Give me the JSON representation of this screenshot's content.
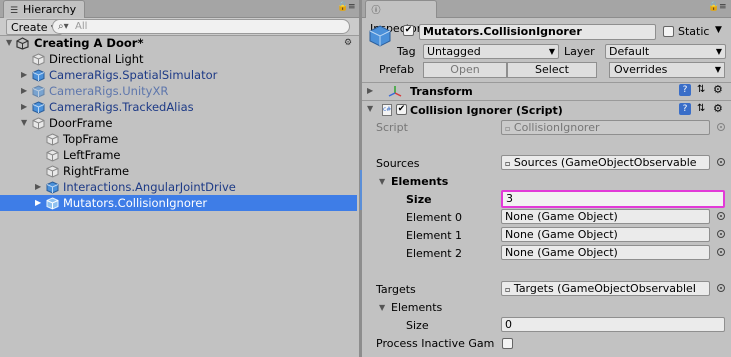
{
  "hierarchy": {
    "tab_label": "Hierarchy",
    "create_label": "Create",
    "search_placeholder": "All",
    "scene_name": "Creating A Door*",
    "items": [
      {
        "label": "Directional Light"
      },
      {
        "label": "CameraRigs.SpatialSimulator"
      },
      {
        "label": "CameraRigs.UnityXR"
      },
      {
        "label": "CameraRigs.TrackedAlias"
      },
      {
        "label": "DoorFrame"
      },
      {
        "label": "TopFrame"
      },
      {
        "label": "LeftFrame"
      },
      {
        "label": "RightFrame"
      },
      {
        "label": "Interactions.AngularJointDrive"
      },
      {
        "label": "Mutators.CollisionIgnorer"
      }
    ]
  },
  "inspector": {
    "tab_label": "Inspector",
    "object_name": "Mutators.CollisionIgnorer",
    "static_label": "Static",
    "tag_label": "Tag",
    "tag_value": "Untagged",
    "layer_label": "Layer",
    "layer_value": "Default",
    "prefab_label": "Prefab",
    "prefab_open": "Open",
    "prefab_select": "Select",
    "prefab_overrides": "Overrides",
    "transform_title": "Transform",
    "component_title": "Collision Ignorer (Script)",
    "script_label": "Script",
    "script_value": "CollisionIgnorer",
    "sources_label": "Sources",
    "sources_value": "Sources (GameObjectObservable",
    "elements_label": "Elements",
    "size_label": "Size",
    "size_value": "3",
    "element0_label": "Element 0",
    "element0_value": "None (Game Object)",
    "element1_label": "Element 1",
    "element1_value": "None (Game Object)",
    "element2_label": "Element 2",
    "element2_value": "None (Game Object)",
    "targets_label": "Targets",
    "targets_value": "Targets (GameObjectObservableI",
    "targets_elements_label": "Elements",
    "targets_size_label": "Size",
    "targets_size_value": "0",
    "process_inactive_label": "Process Inactive Gam"
  },
  "colors": {
    "selection": "#3e7de7",
    "prefab_blue": "#1d3a86",
    "highlight_border": "#e23ad8"
  }
}
